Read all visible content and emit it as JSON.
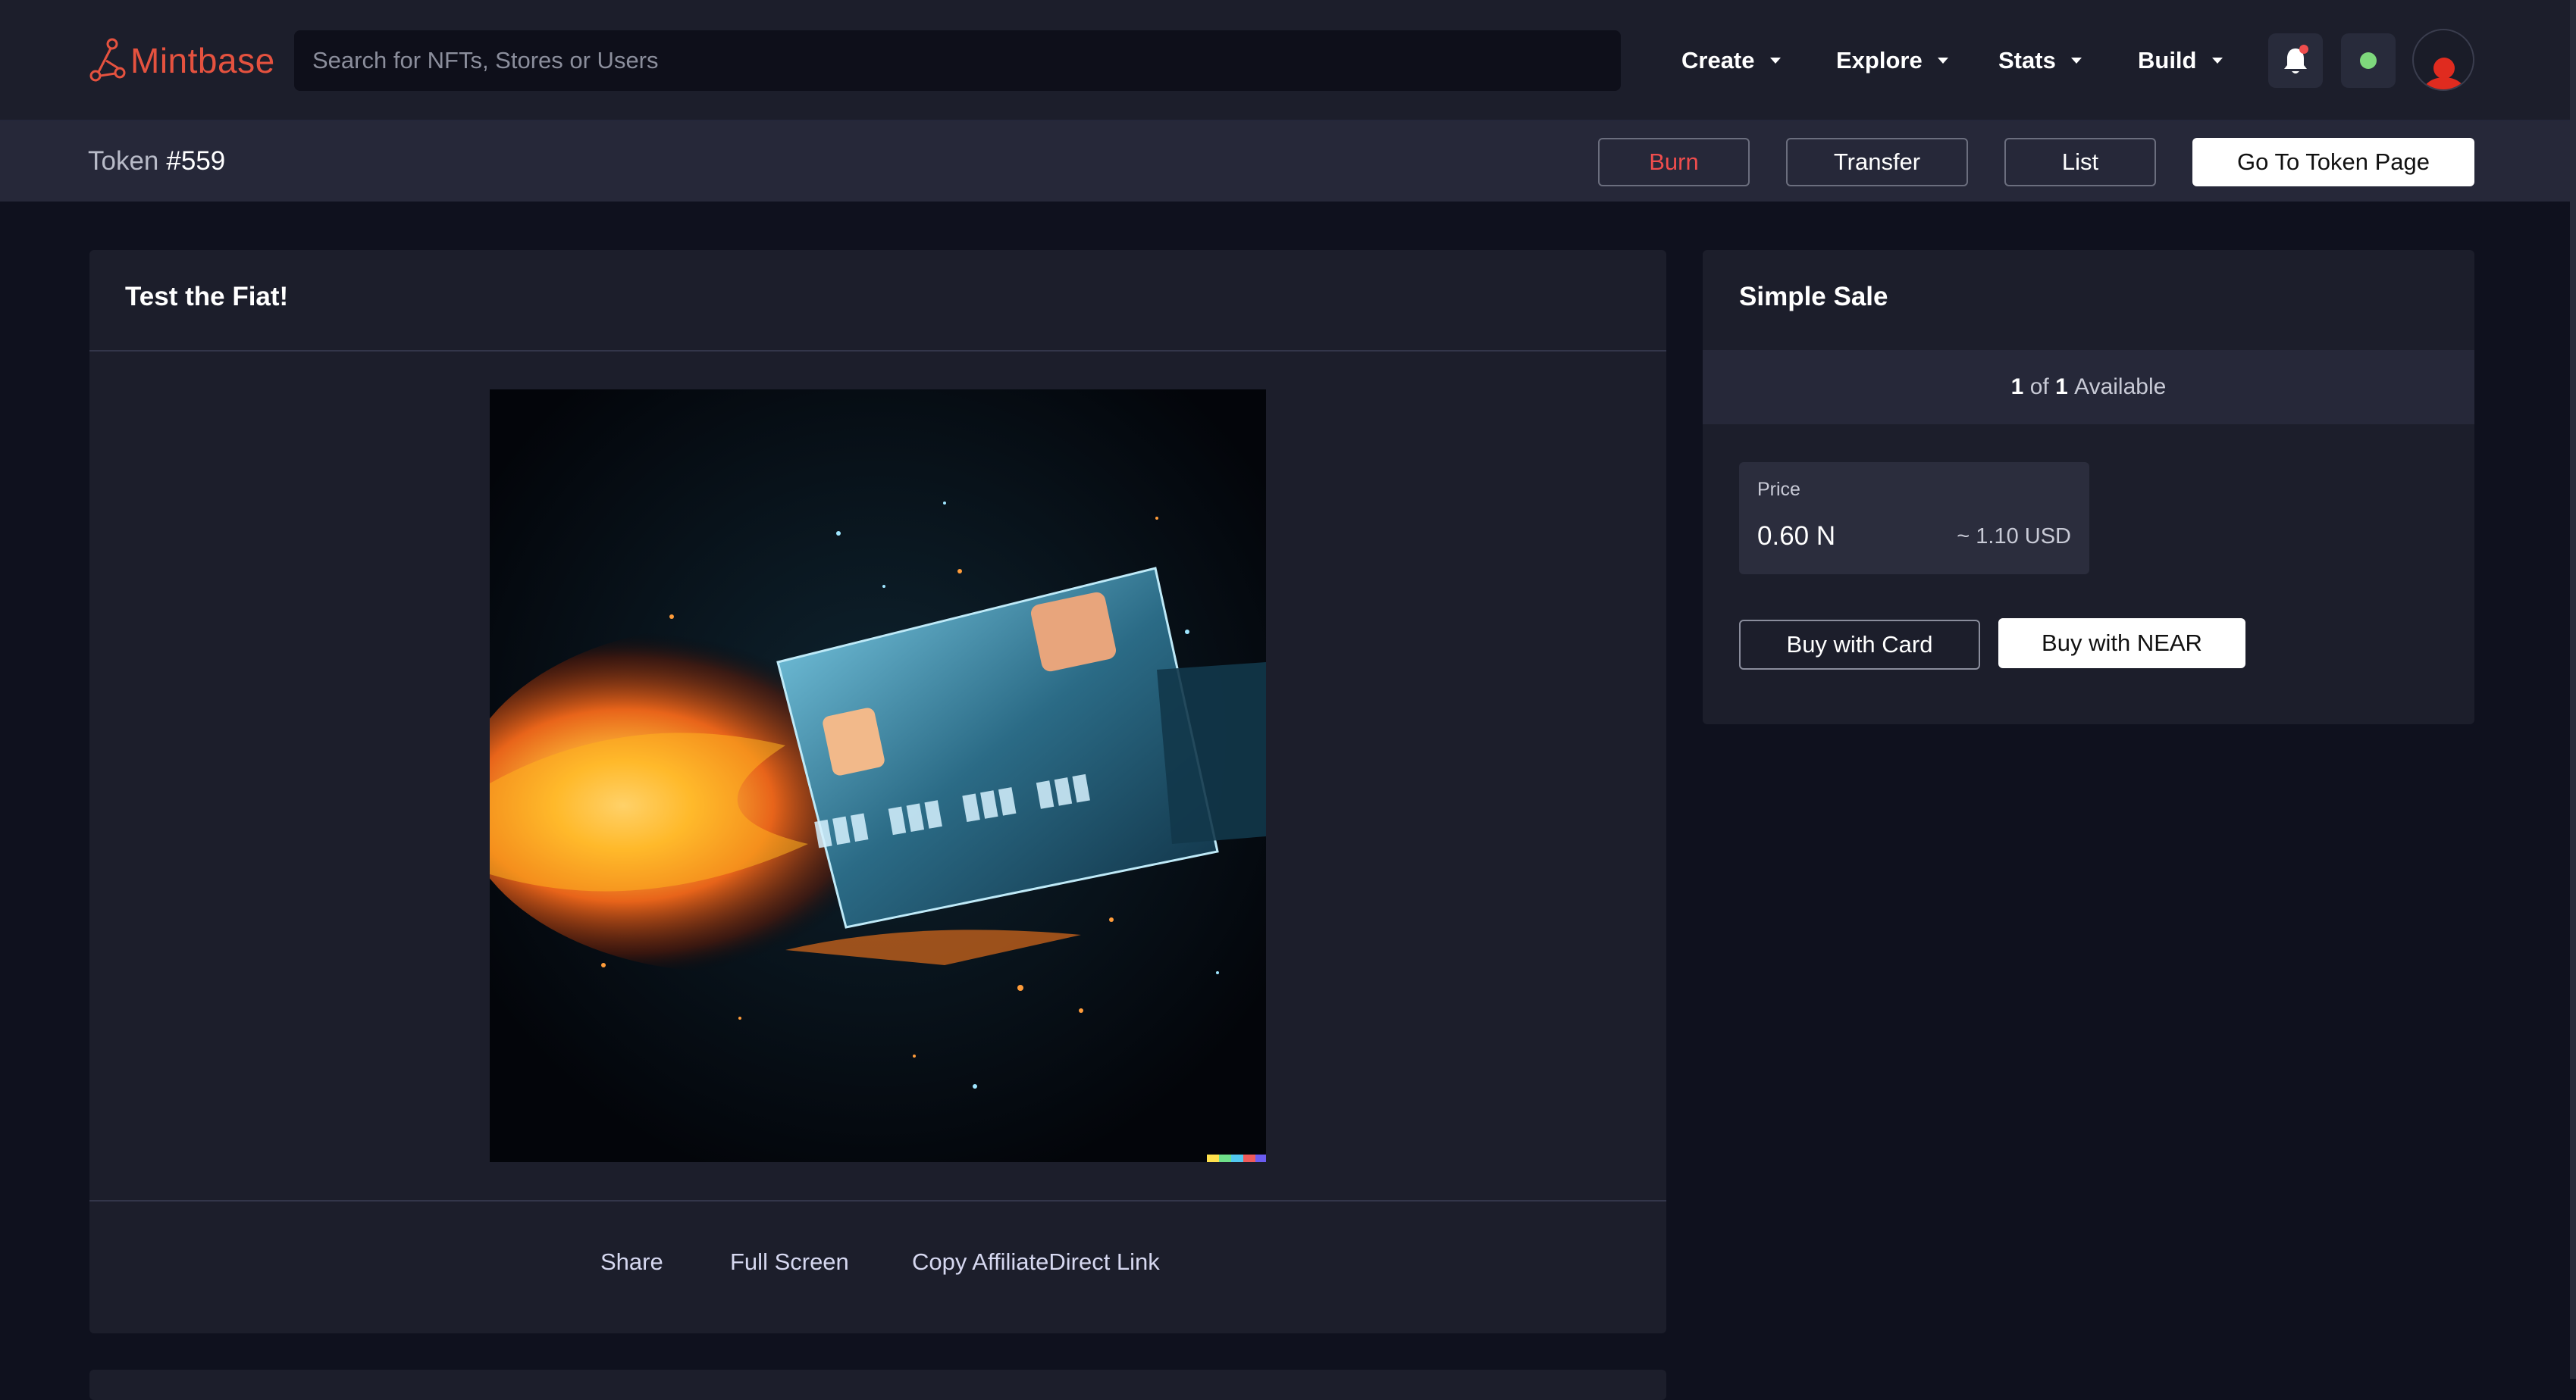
{
  "brand": {
    "name": "Mintbase",
    "color": "#e5523f"
  },
  "search": {
    "placeholder": "Search for NFTs, Stores or Users"
  },
  "nav": {
    "items": [
      {
        "label": "Create"
      },
      {
        "label": "Explore"
      },
      {
        "label": "Stats"
      },
      {
        "label": "Build"
      }
    ],
    "status_color": "#7ed87c",
    "notification_dot_color": "#ef4d4d"
  },
  "subheader": {
    "token_label": "Token",
    "token_number": "#559",
    "actions": {
      "burn": "Burn",
      "transfer": "Transfer",
      "list": "List",
      "go_to_token": "Go To Token Page"
    }
  },
  "nft": {
    "title": "Test the Fiat!",
    "image_alt": "credit-card-on-fire-artwork",
    "links": {
      "share": "Share",
      "full_screen": "Full Screen",
      "copy_link": "Copy AffiliateDirect Link"
    }
  },
  "sale": {
    "title": "Simple Sale",
    "available_count": "1",
    "available_of": "of",
    "available_total": "1",
    "available_label": "Available",
    "price_label": "Price",
    "price_value": "0.60 N",
    "price_usd": "~ 1.10 USD",
    "buy_card": "Buy with Card",
    "buy_near": "Buy with NEAR"
  }
}
